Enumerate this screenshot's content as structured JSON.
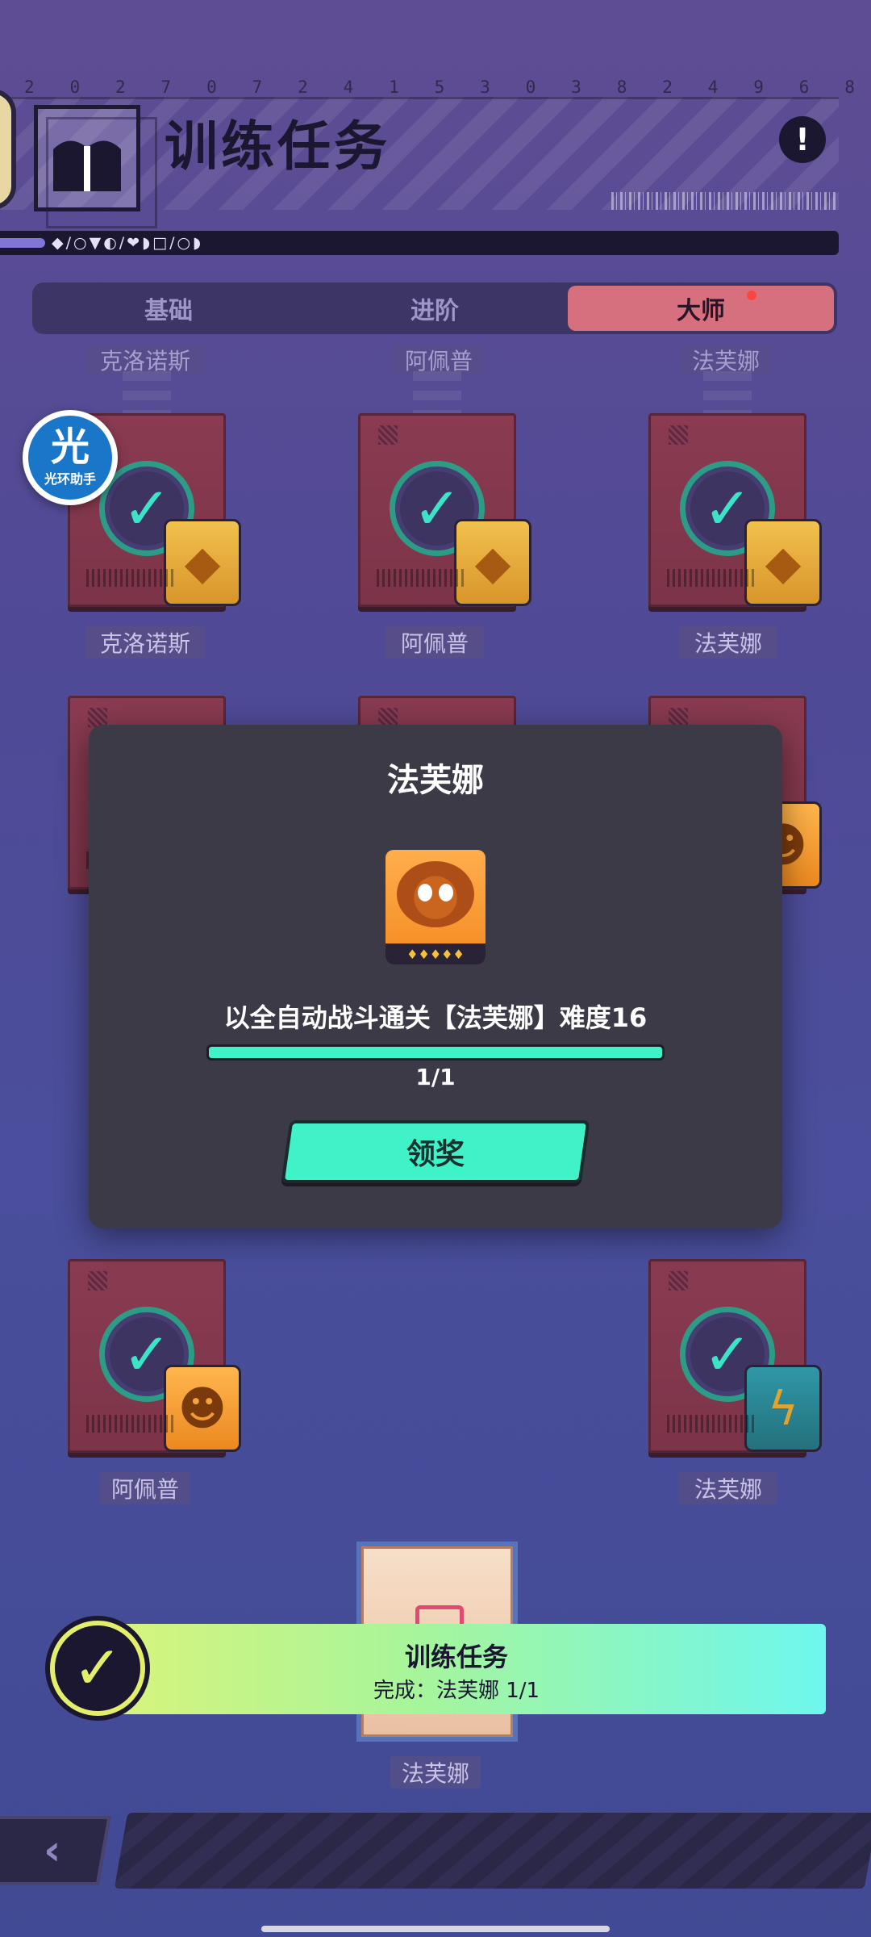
{
  "header": {
    "digits": [
      "2",
      "0",
      "2",
      "7",
      "0",
      "7",
      "2",
      "4",
      "1",
      "5",
      "3",
      "0",
      "3",
      "8",
      "2",
      "4",
      "9",
      "6",
      "8"
    ],
    "title": "训练任务",
    "alert": "!",
    "symbols": "◆/○▼◐/❤◗□/○◗"
  },
  "tabs": [
    {
      "label": "基础",
      "active": false
    },
    {
      "label": "进阶",
      "active": false
    },
    {
      "label": "大师",
      "active": true
    }
  ],
  "grid": {
    "row0_labels": [
      "克洛诺斯",
      "阿佩普",
      "法芙娜"
    ],
    "row1_labels": [
      "克洛诺斯",
      "阿佩普",
      "法芙娜"
    ],
    "row3_labels": [
      "阿佩普",
      "法芙娜"
    ],
    "bottom_label": "法芙娜"
  },
  "floater": {
    "big": "光",
    "small": "光环助手"
  },
  "modal": {
    "title": "法芙娜",
    "stars": "♦♦♦♦♦",
    "description": "以全自动战斗通关【法芙娜】难度16",
    "progress_current": 1,
    "progress_total": 1,
    "progress_text": "1/1",
    "claim_label": "领奖"
  },
  "toast": {
    "title": "训练任务",
    "subtitle": "完成：法芙娜 1/1"
  },
  "footer": {
    "back_icon": "‹"
  },
  "colors": {
    "accent": "#3ff2c8",
    "tab_active": "#d6707e",
    "card": "#8a3b51",
    "modal_bg": "#3b3a46"
  }
}
